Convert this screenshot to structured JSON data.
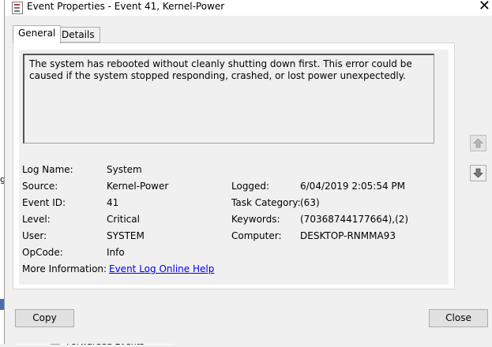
{
  "window": {
    "title": "Event Properties - Event 41, Kernel-Power",
    "close_glyph": "✕"
  },
  "tabs": [
    {
      "label": "General",
      "active": true
    },
    {
      "label": "Details",
      "active": false
    }
  ],
  "description": "The system has rebooted without cleanly shutting down first. This error could be caused if the system stopped responding, crashed, or lost power unexpectedly.",
  "fields": {
    "log_name": {
      "label": "Log Name:",
      "value": "System"
    },
    "source": {
      "label": "Source:",
      "value": "Kernel-Power"
    },
    "event_id": {
      "label": "Event ID:",
      "value": "41"
    },
    "level": {
      "label": "Level:",
      "value": "Critical"
    },
    "user": {
      "label": "User:",
      "value": "SYSTEM"
    },
    "opcode": {
      "label": "OpCode:",
      "value": "Info"
    },
    "more_info": {
      "label": "More Information:",
      "value": "Event Log Online Help"
    },
    "logged": {
      "label": "Logged:",
      "value": "6/04/2019 2:05:54 PM"
    },
    "task_category": {
      "label": "Task Category:",
      "value": "(63)"
    },
    "keywords": {
      "label": "Keywords:",
      "value": "(70368744177664),(2)"
    },
    "computer": {
      "label": "Computer:",
      "value": "DESKTOP-RNMMA93"
    }
  },
  "buttons": {
    "copy": "Copy",
    "close": "Close"
  },
  "background": {
    "partial_letter": "g",
    "tree_item": "Forwarded Events"
  },
  "icons": {
    "app": "event-viewer-icon",
    "up": "up-arrow-icon",
    "down": "down-arrow-icon",
    "close": "close-icon"
  }
}
